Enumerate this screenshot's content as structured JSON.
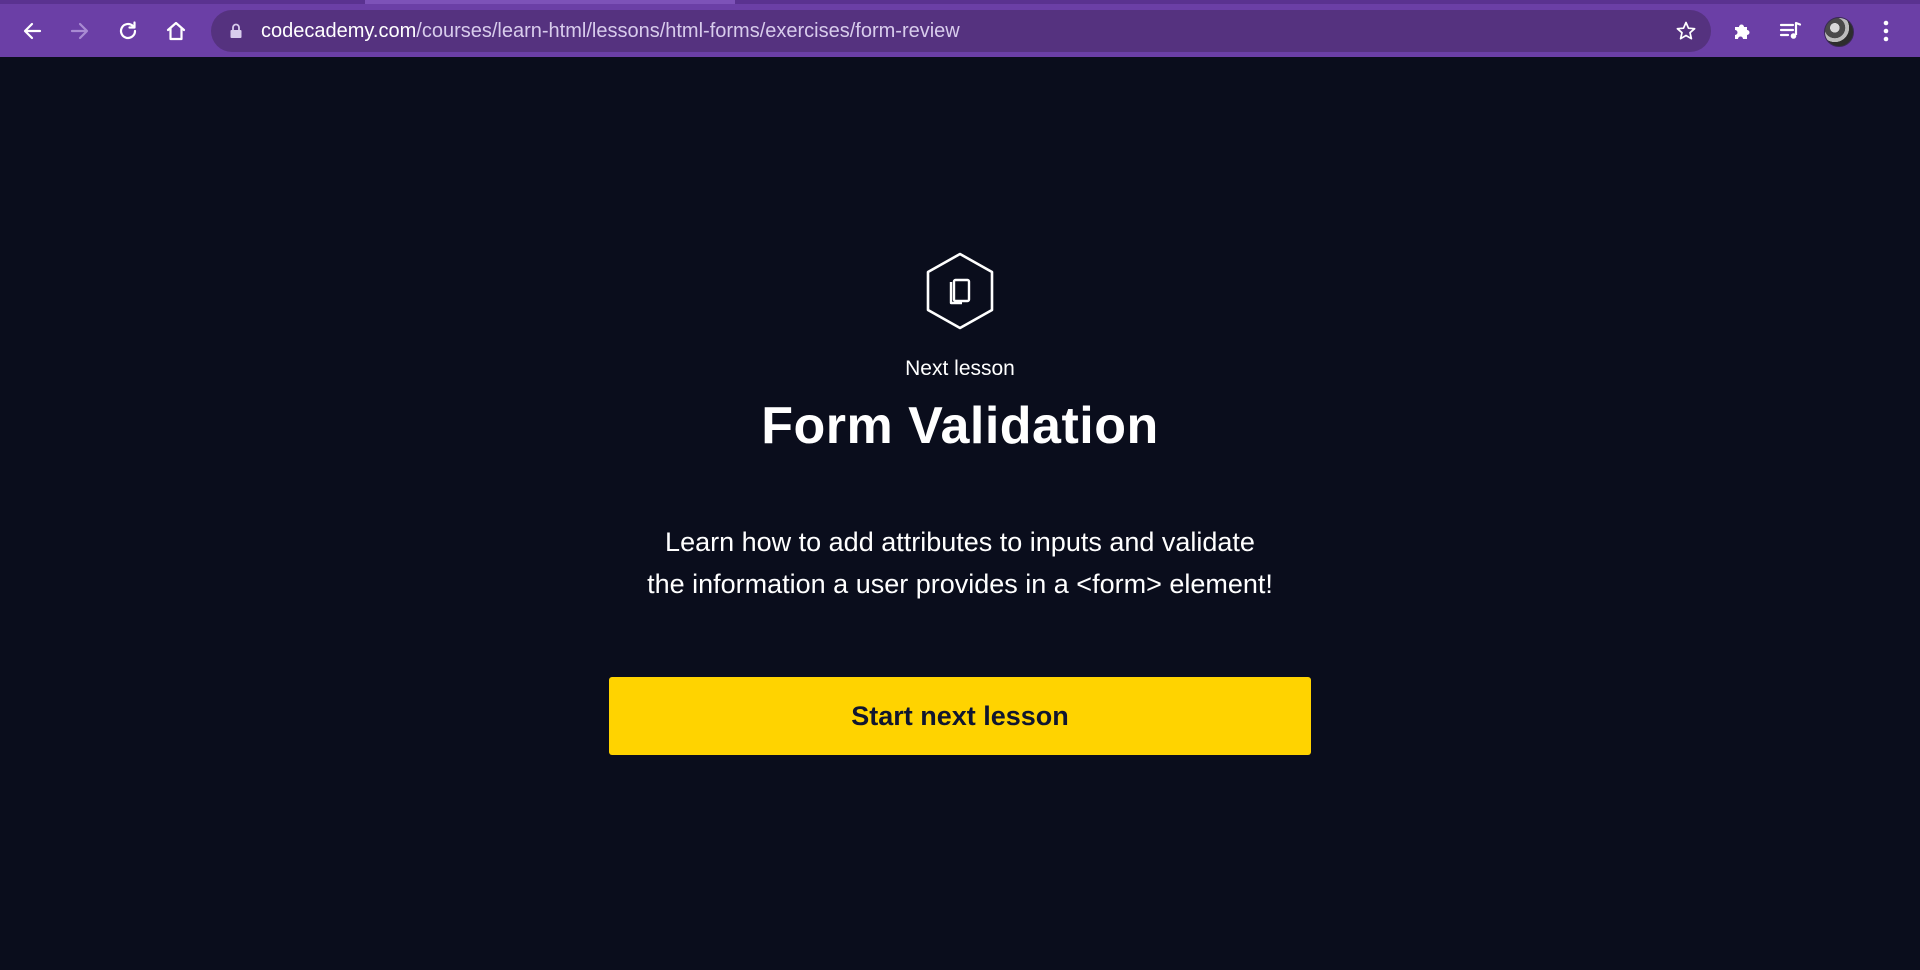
{
  "browser": {
    "url_host": "codecademy.com",
    "url_path": "/courses/learn-html/lessons/html-forms/exercises/form-review",
    "icons": {
      "back": "arrow-left-icon",
      "forward": "arrow-right-icon",
      "reload": "reload-icon",
      "home": "home-icon",
      "lock": "lock-icon",
      "bookmark": "star-icon",
      "extensions": "puzzle-icon",
      "media": "playlist-icon",
      "profile": "avatar",
      "menu": "kebab-menu-icon"
    },
    "colors": {
      "toolbar": "#6b3fa6",
      "omnibox": "#55327f"
    }
  },
  "page": {
    "icon": "lesson-hexagon-icon",
    "eyebrow": "Next lesson",
    "title": "Form Validation",
    "description_line1": "Learn how to add attributes to inputs and validate",
    "description_line2": "the information a user provides in a <form> element!",
    "cta_label": "Start next lesson",
    "colors": {
      "background": "#0a0d1c",
      "cta": "#ffd300",
      "text": "#ffffff"
    }
  }
}
